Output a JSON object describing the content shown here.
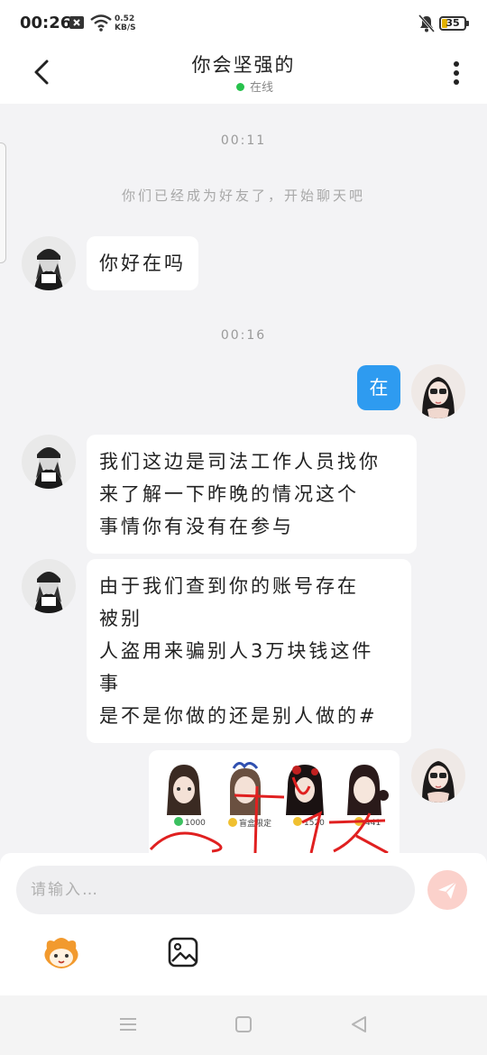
{
  "status_bar": {
    "time": "00:26",
    "net_speed_value": "0.52",
    "net_speed_unit": "KB/S",
    "battery_level": "35",
    "icons": [
      "close-box-icon",
      "wifi-icon",
      "mute-icon",
      "battery-icon"
    ]
  },
  "header": {
    "title": "你会坚强的",
    "status": "在线",
    "status_color": "#27c24c",
    "icons": [
      "back-arrow-icon",
      "more-vertical-icon"
    ]
  },
  "chat": {
    "timestamp_1": "00:11",
    "system_message": "你们已经成为好友了，开始聊天吧",
    "msg_1": "你好在吗",
    "timestamp_2": "00:16",
    "msg_2_out": "在",
    "msg_3_lines": [
      "我们这边是司法工作人员找你",
      "来了解一下昨晚的情况这个",
      "事情你有没有在参与"
    ],
    "msg_4_lines": [
      "由于我们查到你的账号存在",
      "被别",
      "人盗用来骗别人3万块钱这件",
      "事",
      "是不是你做的还是别人做的#"
    ],
    "image_prices": [
      "1000",
      "盲盒限定",
      "1520",
      "441"
    ]
  },
  "composer": {
    "placeholder": "请输入…",
    "icons": [
      "send-icon",
      "emoji-face-icon",
      "image-icon"
    ]
  },
  "nav_bar": {
    "icons": [
      "menu-icon",
      "home-square-icon",
      "back-triangle-icon"
    ]
  },
  "colors": {
    "accent_blue": "#2e9bf0",
    "send_disabled": "#fbd1cb",
    "background": "#f3f3f5"
  }
}
